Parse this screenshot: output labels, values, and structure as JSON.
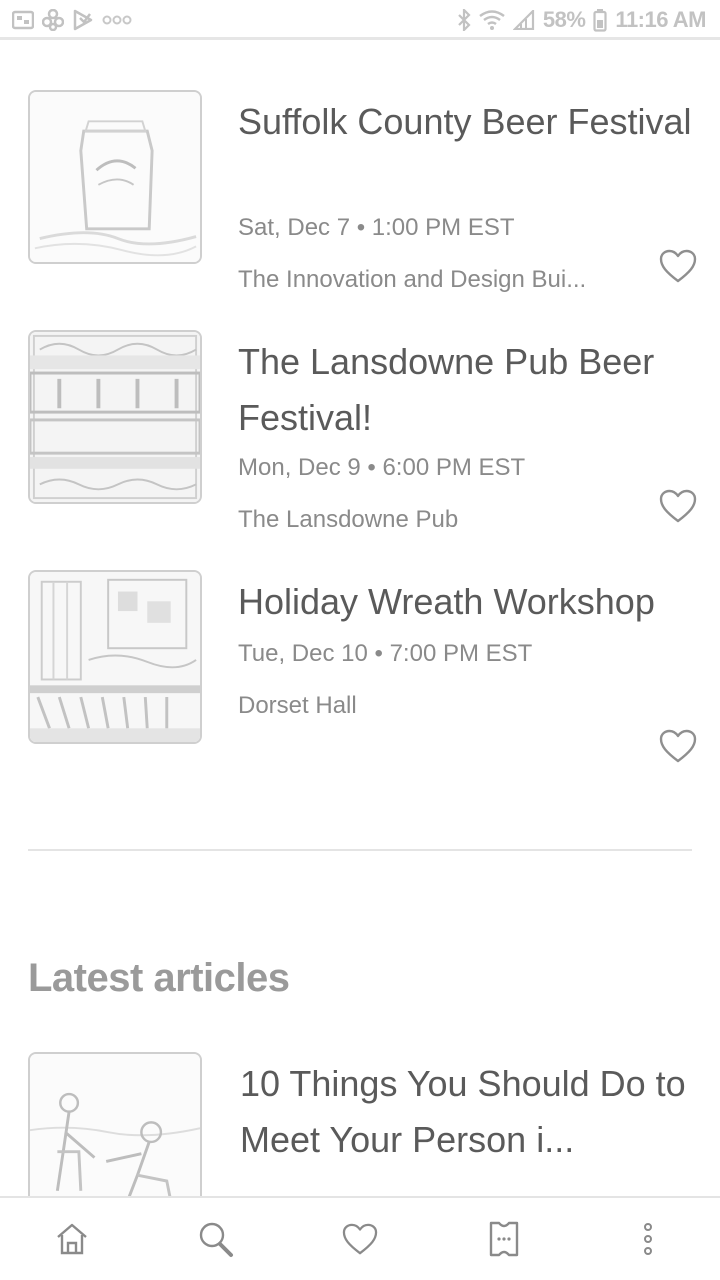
{
  "status_bar": {
    "battery_text": "58%",
    "time": "11:16 AM",
    "left_icons": [
      "gallery-icon",
      "flower-icon",
      "play-store-icon",
      "more-notifications-icon"
    ],
    "right_icons": [
      "bluetooth-icon",
      "wifi-icon",
      "signal-icon",
      "battery-icon"
    ]
  },
  "events": [
    {
      "title": "Suffolk County Beer Festival",
      "date": "Sat, Dec 7 • 1:00 PM EST",
      "venue": "The Innovation and Design Bui...",
      "thumb_icon": "beer-can-image"
    },
    {
      "title": "The Lansdowne Pub Beer Festival!",
      "date": "Mon, Dec 9 • 6:00 PM EST",
      "venue": "The Lansdowne Pub",
      "thumb_icon": "beer-festival-poster-image"
    },
    {
      "title": "Holiday Wreath Workshop",
      "date": "Tue, Dec 10 • 7:00 PM EST",
      "venue": "Dorset Hall",
      "thumb_icon": "hall-interior-image"
    }
  ],
  "section": {
    "title": "Latest articles"
  },
  "articles": [
    {
      "title": "10 Things You Should Do to Meet Your Person i...",
      "thumb_icon": "couple-holding-hands-image"
    }
  ],
  "bottom_nav": [
    "home-icon",
    "search-icon",
    "heart-icon",
    "tickets-icon",
    "more-icon"
  ],
  "colors": {
    "text_primary": "#5a5a5a",
    "text_secondary": "#8a8a8a",
    "divider": "#e4e4e4"
  }
}
